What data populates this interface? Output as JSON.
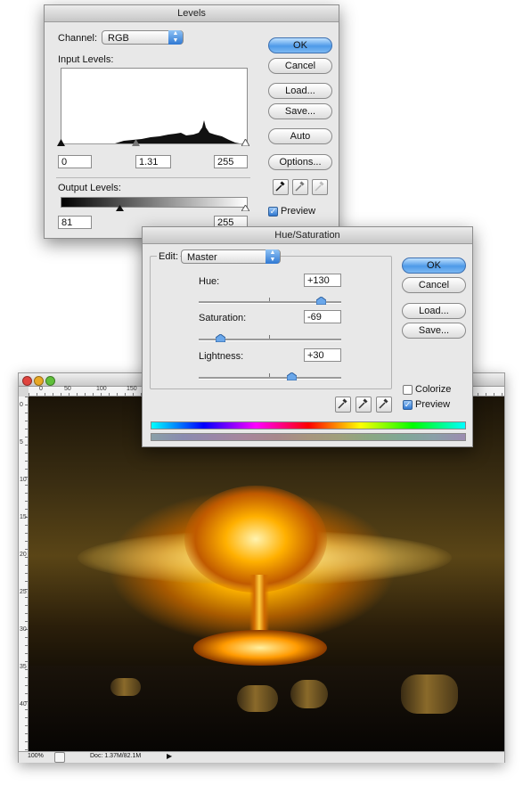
{
  "levels": {
    "title": "Levels",
    "channel_label": "Channel:",
    "channel_value": "RGB",
    "input_levels_label": "Input Levels:",
    "input_black": "0",
    "input_gamma": "1.31",
    "input_white": "255",
    "output_levels_label": "Output Levels:",
    "output_black": "81",
    "output_white": "255",
    "buttons": {
      "ok": "OK",
      "cancel": "Cancel",
      "load": "Load...",
      "save": "Save...",
      "auto": "Auto",
      "options": "Options..."
    },
    "preview_label": "Preview",
    "preview_checked": true
  },
  "hue_saturation": {
    "title": "Hue/Saturation",
    "edit_label": "Edit:",
    "edit_value": "Master",
    "hue_label": "Hue:",
    "hue_value": "+130",
    "hue": 130,
    "saturation_label": "Saturation:",
    "saturation_value": "-69",
    "saturation": -69,
    "lightness_label": "Lightness:",
    "lightness_value": "+30",
    "lightness": 30,
    "buttons": {
      "ok": "OK",
      "cancel": "Cancel",
      "load": "Load...",
      "save": "Save..."
    },
    "colorize_label": "Colorize",
    "colorize_checked": false,
    "preview_label": "Preview",
    "preview_checked": true
  },
  "document": {
    "ruler_labels": [
      "0",
      "50",
      "100",
      "150"
    ],
    "ruler_v_labels": [
      "0",
      "5",
      "10",
      "15",
      "20",
      "25",
      "30",
      "35",
      "40"
    ],
    "zoom": "100%",
    "doc_info": "Doc: 1.37M/82.1M"
  },
  "colors": {
    "default_button": "#4e9ae8",
    "dialog_bg": "#e8e8e8"
  }
}
